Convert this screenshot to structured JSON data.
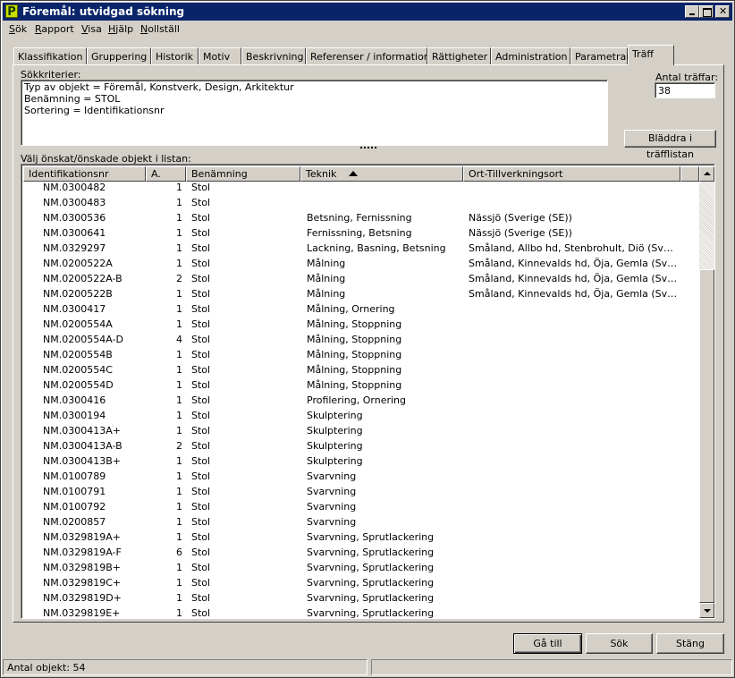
{
  "window": {
    "title": "Föremål: utvidgad sökning",
    "app_icon_letter": "P"
  },
  "menu": [
    {
      "label": "Sök",
      "u": "S",
      "rest": "ök"
    },
    {
      "label": "Rapport",
      "u": "R",
      "rest": "apport"
    },
    {
      "label": "Visa",
      "u": "V",
      "rest": "isa"
    },
    {
      "label": "Hjälp",
      "u": "H",
      "rest": "jälp"
    },
    {
      "label": "Nollställ",
      "u": "N",
      "rest": "ollställ"
    }
  ],
  "tabs": [
    "Klassifikation",
    "Gruppering",
    "Historik",
    "Motiv",
    "Beskrivning",
    "Referenser / information",
    "Rättigheter",
    "Administration",
    "Parametrar",
    "Träff"
  ],
  "active_tab": "Träff",
  "search": {
    "criteria_label": "Sökkriterier:",
    "criteria_text": "Typ av objekt = Föremål, Konstverk, Design, Arkitektur\nBenämning = STOL\nSortering = Identifikationsnr",
    "hits_label": "Antal träffar:",
    "hits_value": "38",
    "browse_button": "Bläddra i träfflistan"
  },
  "list": {
    "instruction": "Välj önskat/önskade objekt i listan:",
    "columns": [
      "Identifikationsnr",
      "A.",
      "Benämning",
      "Teknik",
      "Ort-Tillverkningsort"
    ],
    "sorted_column": "Teknik",
    "rows": [
      [
        "NM.0300482",
        "1",
        "Stol",
        "",
        ""
      ],
      [
        "NM.0300483",
        "1",
        "Stol",
        "",
        ""
      ],
      [
        "NM.0300536",
        "1",
        "Stol",
        "Betsning, Fernissning",
        "Nässjö (Sverige (SE))"
      ],
      [
        "NM.0300641",
        "1",
        "Stol",
        "Fernissning, Betsning",
        "Nässjö (Sverige (SE))"
      ],
      [
        "NM.0329297",
        "1",
        "Stol",
        "Lackning, Basning, Betsning",
        "Småland, Allbo hd, Stenbrohult, Diö (Sveri..."
      ],
      [
        "NM.0200522A",
        "1",
        "Stol",
        "Målning",
        "Småland, Kinnevalds hd, Öja, Gemla (Sverig..."
      ],
      [
        "NM.0200522A-B",
        "2",
        "Stol",
        "Målning",
        "Småland, Kinnevalds hd, Öja, Gemla (Sverig..."
      ],
      [
        "NM.0200522B",
        "1",
        "Stol",
        "Målning",
        "Småland, Kinnevalds hd, Öja, Gemla (Sverig..."
      ],
      [
        "NM.0300417",
        "1",
        "Stol",
        "Målning, Ornering",
        ""
      ],
      [
        "NM.0200554A",
        "1",
        "Stol",
        "Målning, Stoppning",
        ""
      ],
      [
        "NM.0200554A-D",
        "4",
        "Stol",
        "Målning, Stoppning",
        ""
      ],
      [
        "NM.0200554B",
        "1",
        "Stol",
        "Målning, Stoppning",
        ""
      ],
      [
        "NM.0200554C",
        "1",
        "Stol",
        "Målning, Stoppning",
        ""
      ],
      [
        "NM.0200554D",
        "1",
        "Stol",
        "Målning, Stoppning",
        ""
      ],
      [
        "NM.0300416",
        "1",
        "Stol",
        "Profilering, Ornering",
        ""
      ],
      [
        "NM.0300194",
        "1",
        "Stol",
        "Skulptering",
        ""
      ],
      [
        "NM.0300413A+",
        "1",
        "Stol",
        "Skulptering",
        ""
      ],
      [
        "NM.0300413A-B",
        "2",
        "Stol",
        "Skulptering",
        ""
      ],
      [
        "NM.0300413B+",
        "1",
        "Stol",
        "Skulptering",
        ""
      ],
      [
        "NM.0100789",
        "1",
        "Stol",
        "Svarvning",
        ""
      ],
      [
        "NM.0100791",
        "1",
        "Stol",
        "Svarvning",
        ""
      ],
      [
        "NM.0100792",
        "1",
        "Stol",
        "Svarvning",
        ""
      ],
      [
        "NM.0200857",
        "1",
        "Stol",
        "Svarvning",
        ""
      ],
      [
        "NM.0329819A+",
        "1",
        "Stol",
        "Svarvning, Sprutlackering",
        ""
      ],
      [
        "NM.0329819A-F",
        "6",
        "Stol",
        "Svarvning, Sprutlackering",
        ""
      ],
      [
        "NM.0329819B+",
        "1",
        "Stol",
        "Svarvning, Sprutlackering",
        ""
      ],
      [
        "NM.0329819C+",
        "1",
        "Stol",
        "Svarvning, Sprutlackering",
        ""
      ],
      [
        "NM.0329819D+",
        "1",
        "Stol",
        "Svarvning, Sprutlackering",
        ""
      ],
      [
        "NM.0329819E+",
        "1",
        "Stol",
        "Svarvning, Sprutlackering",
        ""
      ]
    ]
  },
  "buttons": {
    "goto": "Gå till",
    "search": "Sök",
    "close": "Stäng"
  },
  "status": {
    "count_text": "Antal objekt: 54"
  },
  "colors": {
    "titlebar": "#0a246a",
    "face": "#d4d0c8"
  }
}
